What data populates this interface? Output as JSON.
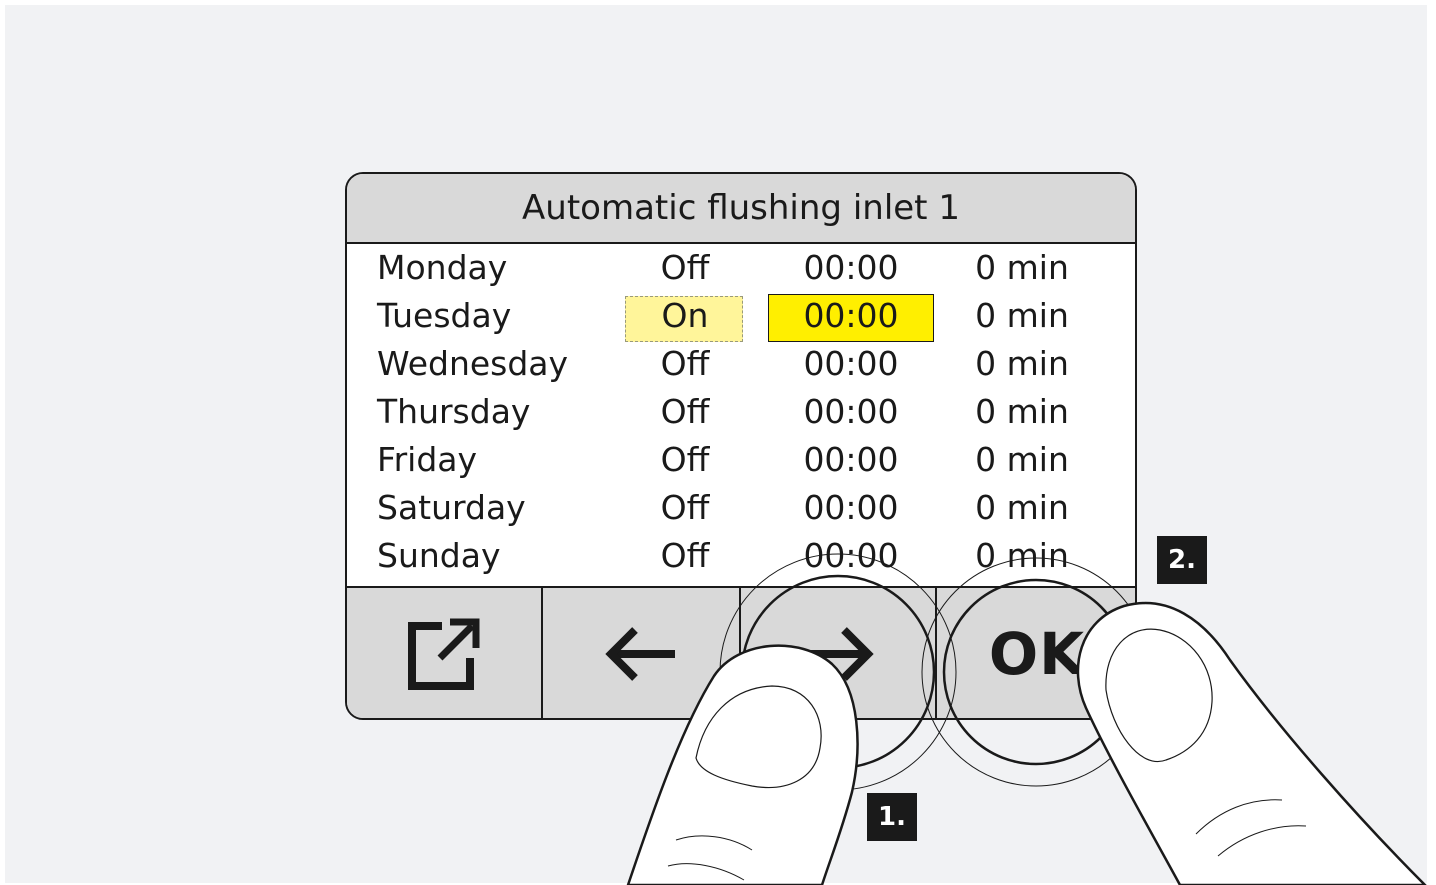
{
  "panel": {
    "title": "Automatic flushing inlet 1"
  },
  "schedule": {
    "rows": [
      {
        "day": "Monday",
        "state": "Off",
        "time": "00:00",
        "duration": "0 min"
      },
      {
        "day": "Tuesday",
        "state": "On",
        "time": "00:00",
        "duration": "0 min"
      },
      {
        "day": "Wednesday",
        "state": "Off",
        "time": "00:00",
        "duration": "0 min"
      },
      {
        "day": "Thursday",
        "state": "Off",
        "time": "00:00",
        "duration": "0 min"
      },
      {
        "day": "Friday",
        "state": "Off",
        "time": "00:00",
        "duration": "0 min"
      },
      {
        "day": "Saturday",
        "state": "Off",
        "time": "00:00",
        "duration": "0 min"
      },
      {
        "day": "Sunday",
        "state": "Off",
        "time": "00:00",
        "duration": "0 min"
      }
    ],
    "selected_row": "Tuesday",
    "highlight_colors": {
      "state_field": "#fff59a",
      "time_field": "#ffef00"
    }
  },
  "buttons": {
    "export_icon": "export-icon",
    "left_icon": "arrow-left-icon",
    "right_icon": "arrow-right-icon",
    "ok_label": "OK"
  },
  "instructions": {
    "step1": "1.",
    "step2": "2."
  },
  "colors": {
    "background": "#f1f2f4",
    "bar": "#d9d9d9",
    "ink": "#1a1a1a"
  }
}
